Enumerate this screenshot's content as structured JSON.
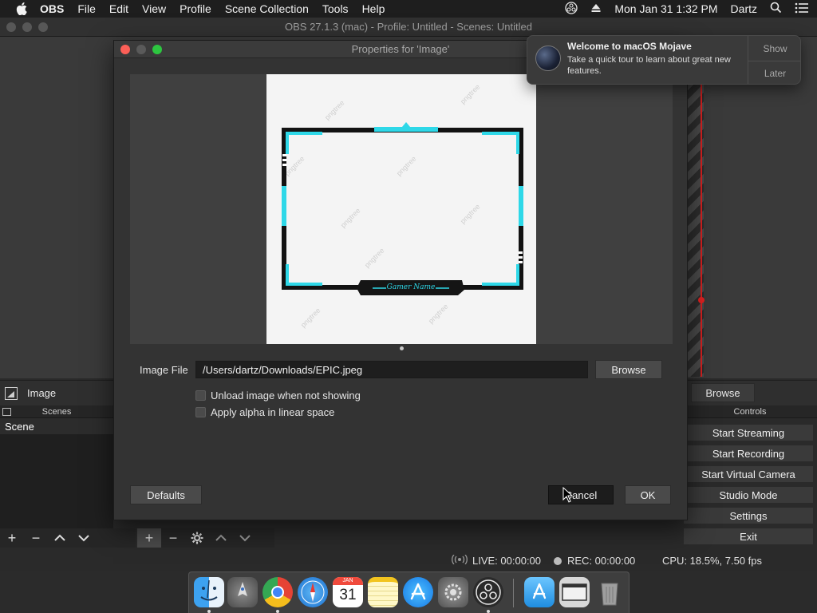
{
  "menubar": {
    "items": [
      "OBS",
      "File",
      "Edit",
      "View",
      "Profile",
      "Scene Collection",
      "Tools",
      "Help"
    ],
    "clock": "Mon Jan 31  1:32 PM",
    "user": "Dartz",
    "icons": [
      "apple-icon",
      "obs-status-icon",
      "eject-icon",
      "search-icon",
      "list-icon"
    ]
  },
  "obs": {
    "window_title": "OBS 27.1.3 (mac) - Profile: Untitled - Scenes: Untitled",
    "source_name": "Image",
    "source_browse_label": "Browse",
    "scenes_header": "Scenes",
    "scene_item": "Scene",
    "controls_header": "Controls",
    "controls": [
      "Start Streaming",
      "Start Recording",
      "Start Virtual Camera",
      "Studio Mode",
      "Settings",
      "Exit"
    ],
    "status": {
      "live": "LIVE: 00:00:00",
      "rec": "REC: 00:00:00",
      "cpu": "CPU: 18.5%, 7.50 fps"
    }
  },
  "dialog": {
    "title": "Properties for 'Image'",
    "image_file_label": "Image File",
    "image_file_path": "/Users/dartz/Downloads/EPIC.jpeg",
    "browse_label": "Browse",
    "checkboxes": [
      {
        "label": "Unload image when not showing",
        "checked": false
      },
      {
        "label": "Apply alpha in linear space",
        "checked": false
      }
    ],
    "defaults_label": "Defaults",
    "cancel_label": "Cancel",
    "ok_label": "OK",
    "preview_frame_text": "Gamer Name",
    "preview_watermark": "pngtree"
  },
  "notification": {
    "title": "Welcome to macOS Mojave",
    "body": "Take a quick tour to learn about great new features.",
    "show_label": "Show",
    "later_label": "Later"
  },
  "dock": {
    "calendar_month": "JAN",
    "calendar_day": "31",
    "apps": [
      "finder-icon",
      "launchpad-icon",
      "chrome-icon",
      "safari-icon",
      "calendar-icon",
      "notes-icon",
      "app-store-icon",
      "system-preferences-icon",
      "obs-icon",
      "downloads-icon",
      "window-icon",
      "trash-icon"
    ]
  },
  "colors": {
    "frame_accent": "#2ed8e8",
    "notification_bg": "#3a3a3a",
    "red_marker": "#d62020"
  }
}
